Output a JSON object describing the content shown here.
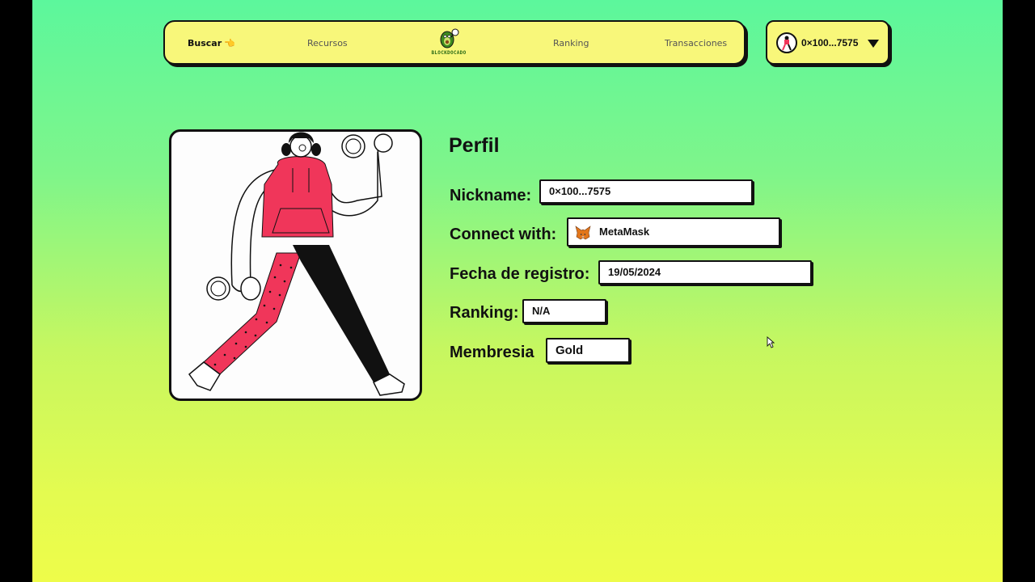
{
  "nav": {
    "search_label": "Buscar",
    "search_icon": "pointing-hand-icon",
    "recursos_label": "Recursos",
    "ranking_label": "Ranking",
    "transacciones_label": "Transacciones",
    "logo_text": "BLOCKDOCADO"
  },
  "wallet": {
    "address": "0×100...7575",
    "caret_icon": "caret-down-icon"
  },
  "profile": {
    "title": "Perfil",
    "nickname_label": "Nickname:",
    "nickname_value": "0×100...7575",
    "connect_label": "Connect with:",
    "connect_value": "MetaMask",
    "connect_icon": "metamask-fox-icon",
    "fecha_label": "Fecha de registro:",
    "fecha_value": "19/05/2024",
    "ranking_label": "Ranking:",
    "ranking_value": "N/A",
    "membresia_label": "Membresia",
    "membresia_value": "Gold"
  },
  "colors": {
    "nav_bg": "#f8f77a",
    "gradient_top": "#5cf79c",
    "gradient_bottom": "#eefc4a",
    "hoodie": "#f0365a",
    "border": "#111111"
  }
}
